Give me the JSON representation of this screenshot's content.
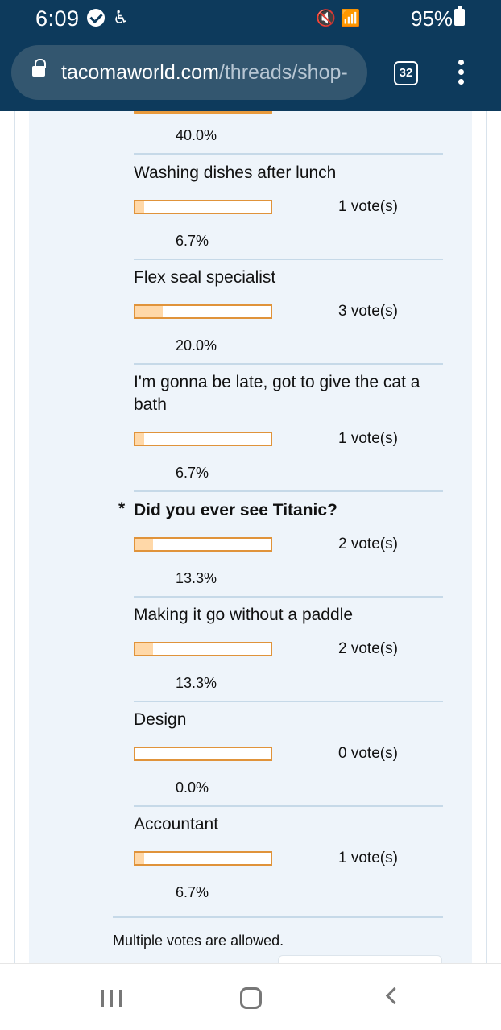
{
  "status_bar": {
    "time": "6:09",
    "battery": "95%",
    "icons": [
      "verified-check-icon",
      "accessibility-icon",
      "mute-icon",
      "wifi-icon",
      "signal-icon",
      "battery-icon"
    ]
  },
  "browser": {
    "url_host": "tacomaworld.com",
    "url_path": "/threads/shop-",
    "tab_count": "32"
  },
  "poll": {
    "previous_pct": "40.0%",
    "options": [
      {
        "label": "Washing dishes after lunch",
        "votes": "1 vote(s)",
        "percent": "6.7%",
        "fraction": 0.067,
        "voted": false
      },
      {
        "label": "Flex seal specialist",
        "votes": "3 vote(s)",
        "percent": "20.0%",
        "fraction": 0.2,
        "voted": false
      },
      {
        "label": "I'm gonna be late, got to give the cat a bath",
        "votes": "1 vote(s)",
        "percent": "6.7%",
        "fraction": 0.067,
        "voted": false
      },
      {
        "label": "Did you ever see Titanic?",
        "votes": "2 vote(s)",
        "percent": "13.3%",
        "fraction": 0.133,
        "voted": true,
        "marker": "*"
      },
      {
        "label": "Making it go without a paddle",
        "votes": "2 vote(s)",
        "percent": "13.3%",
        "fraction": 0.133,
        "voted": false
      },
      {
        "label": "Design",
        "votes": "0 vote(s)",
        "percent": "0.0%",
        "fraction": 0.0,
        "voted": false
      },
      {
        "label": "Accountant",
        "votes": "1 vote(s)",
        "percent": "6.7%",
        "fraction": 0.067,
        "voted": false
      }
    ],
    "note": "Multiple votes are allowed."
  },
  "colors": {
    "header_bg": "#0d3a5c",
    "panel_bg": "#eef4fa",
    "bar_border": "#e0933a",
    "bar_fill": "#ffd8a8"
  }
}
